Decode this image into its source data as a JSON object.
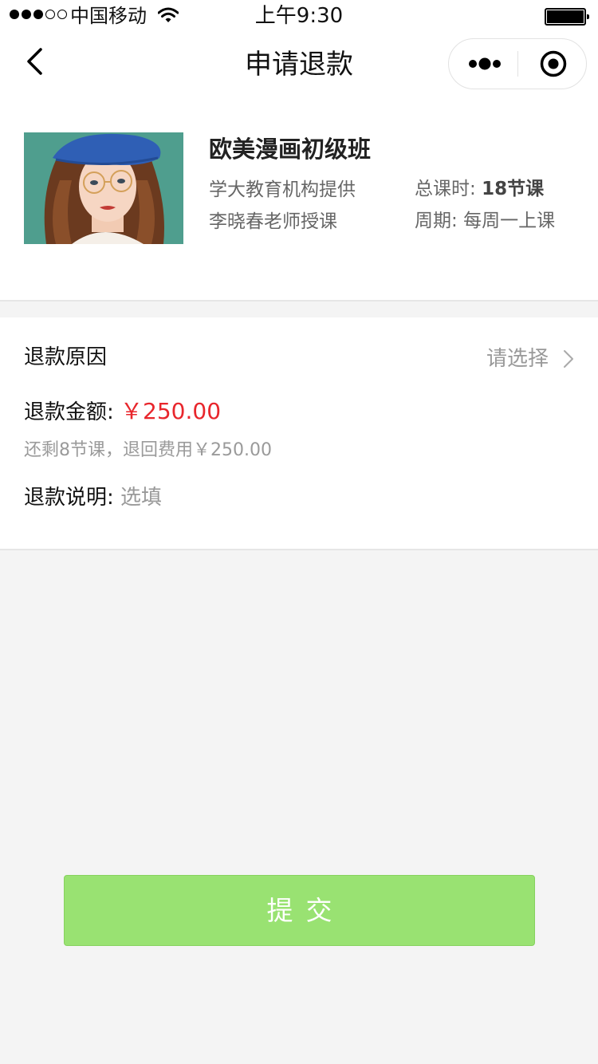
{
  "status_bar": {
    "carrier": "中国移动",
    "time": "上午9:30"
  },
  "nav": {
    "title": "申请退款"
  },
  "course": {
    "name": "欧美漫画初级班",
    "provider": "学大教育机构提供",
    "teacher": "李晓春老师授课",
    "total_hours_label": "总课时:",
    "total_hours_value": "18节课",
    "period_label": "周期:",
    "period_value": "每周一上课"
  },
  "refund": {
    "reason_label": "退款原因",
    "reason_placeholder": "请选择",
    "amount_label": "退款金额:",
    "amount_value": "￥250.00",
    "remaining_hint": "还剩8节课，退回费用￥250.00",
    "note_label": "退款说明:",
    "note_placeholder": "选填"
  },
  "submit_label": "提交",
  "colors": {
    "accent_green": "#99e272",
    "price_red": "#e8262c"
  }
}
